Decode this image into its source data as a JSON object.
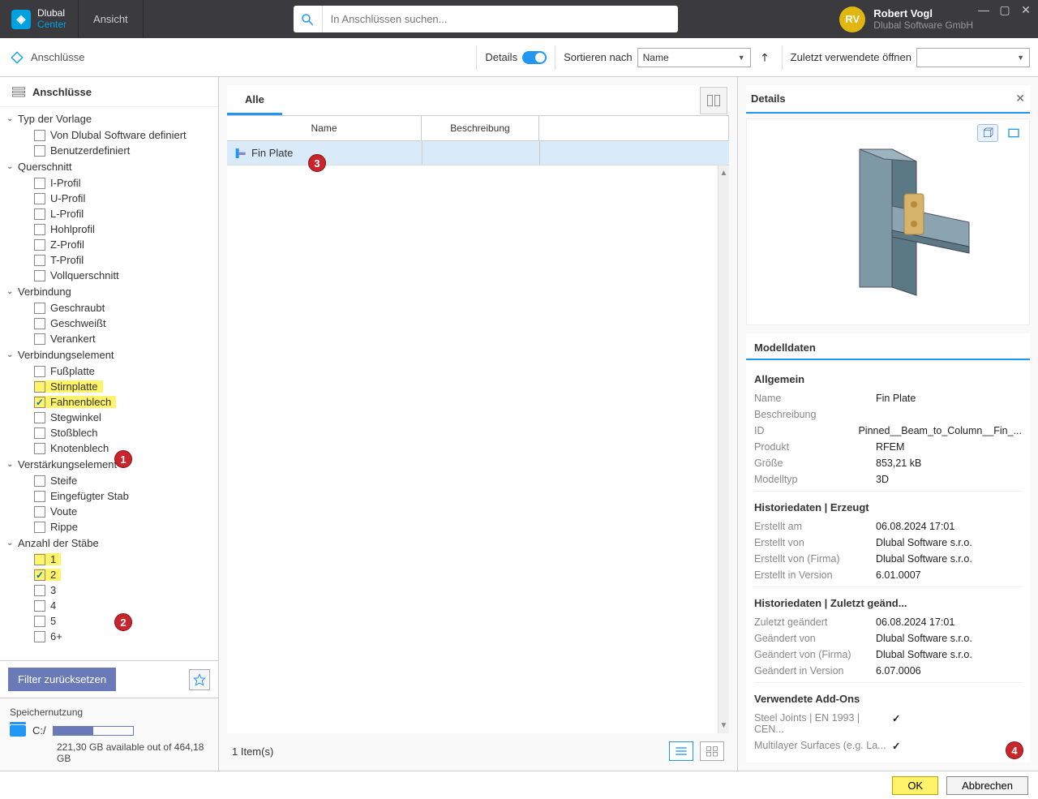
{
  "topbar": {
    "brand1": "Dlubal",
    "brand2": "Center",
    "view": "Ansicht",
    "search_placeholder": "In Anschlüssen suchen...",
    "avatar": "RV",
    "user_name": "Robert Vogl",
    "user_company": "Dlubal Software GmbH"
  },
  "toolbar": {
    "title": "Anschlüsse",
    "details": "Details",
    "sort": "Sortieren nach",
    "sort_value": "Name",
    "recent": "Zuletzt verwendete öffnen",
    "recent_value": ""
  },
  "sidebar": {
    "header": "Anschlüsse",
    "reset": "Filter zurücksetzen",
    "storage_title": "Speichernutzung",
    "drive": "C:/",
    "storage_sub": "221,30 GB available out of 464,18 GB",
    "groups": [
      {
        "name": "Typ der Vorlage",
        "items": [
          {
            "label": "Von Dlubal Software definiert"
          },
          {
            "label": "Benutzerdefiniert"
          }
        ]
      },
      {
        "name": "Querschnitt",
        "items": [
          {
            "label": "I-Profil"
          },
          {
            "label": "U-Profil"
          },
          {
            "label": "L-Profil"
          },
          {
            "label": "Hohlprofil"
          },
          {
            "label": "Z-Profil"
          },
          {
            "label": "T-Profil"
          },
          {
            "label": "Vollquerschnitt"
          }
        ]
      },
      {
        "name": "Verbindung",
        "items": [
          {
            "label": "Geschraubt"
          },
          {
            "label": "Geschweißt"
          },
          {
            "label": "Verankert"
          }
        ]
      },
      {
        "name": "Verbindungselement",
        "items": [
          {
            "label": "Fußplatte"
          },
          {
            "label": "Stirnplatte",
            "hi": true
          },
          {
            "label": "Fahnenblech",
            "hi": true,
            "checked": true
          },
          {
            "label": "Stegwinkel"
          },
          {
            "label": "Stoßblech"
          },
          {
            "label": "Knotenblech"
          }
        ]
      },
      {
        "name": "Verstärkungselement",
        "items": [
          {
            "label": "Steife"
          },
          {
            "label": "Eingefügter Stab"
          },
          {
            "label": "Voute"
          },
          {
            "label": "Rippe"
          }
        ]
      },
      {
        "name": "Anzahl der Stäbe",
        "items": [
          {
            "label": "1",
            "hi": true
          },
          {
            "label": "2",
            "hi": true,
            "checked": true
          },
          {
            "label": "3"
          },
          {
            "label": "4"
          },
          {
            "label": "5"
          },
          {
            "label": "6+"
          }
        ]
      }
    ]
  },
  "center": {
    "tab": "Alle",
    "col_name": "Name",
    "col_desc": "Beschreibung",
    "row_name": "Fin Plate",
    "count": "1 Item(s)"
  },
  "details": {
    "title": "Details",
    "model_tab": "Modelldaten",
    "sections": {
      "s1": "Allgemein",
      "s2": "Historiedaten | Erzeugt",
      "s3": "Historiedaten | Zuletzt geänd...",
      "s4": "Verwendete Add-Ons"
    },
    "labels": {
      "name": "Name",
      "desc": "Beschreibung",
      "id": "ID",
      "product": "Produkt",
      "size": "Größe",
      "modeltype": "Modelltyp",
      "created_on": "Erstellt am",
      "created_by": "Erstellt von",
      "created_by_company": "Erstellt von (Firma)",
      "created_in_version": "Erstellt in Version",
      "modified_on": "Zuletzt geändert",
      "modified_by": "Geändert von",
      "modified_by_company": "Geändert von (Firma)",
      "modified_in_version": "Geändert in Version",
      "addon1": "Steel Joints | EN 1993 | CEN...",
      "addon2": "Multilayer Surfaces (e.g. La..."
    },
    "values": {
      "name": "Fin Plate",
      "desc": "",
      "id": "Pinned__Beam_to_Column__Fin_...",
      "product": "RFEM",
      "size": "853,21 kB",
      "modeltype": "3D",
      "created_on": "06.08.2024 17:01",
      "created_by": "Dlubal Software s.r.o.",
      "created_by_company": "Dlubal Software s.r.o.",
      "created_in_version": "6.01.0007",
      "modified_on": "06.08.2024 17:01",
      "modified_by": "Dlubal Software s.r.o.",
      "modified_by_company": "Dlubal Software s.r.o.",
      "modified_in_version": "6.07.0006"
    }
  },
  "footer": {
    "ok": "OK",
    "cancel": "Abbrechen"
  },
  "badges": {
    "b1": "1",
    "b2": "2",
    "b3": "3",
    "b4": "4"
  }
}
